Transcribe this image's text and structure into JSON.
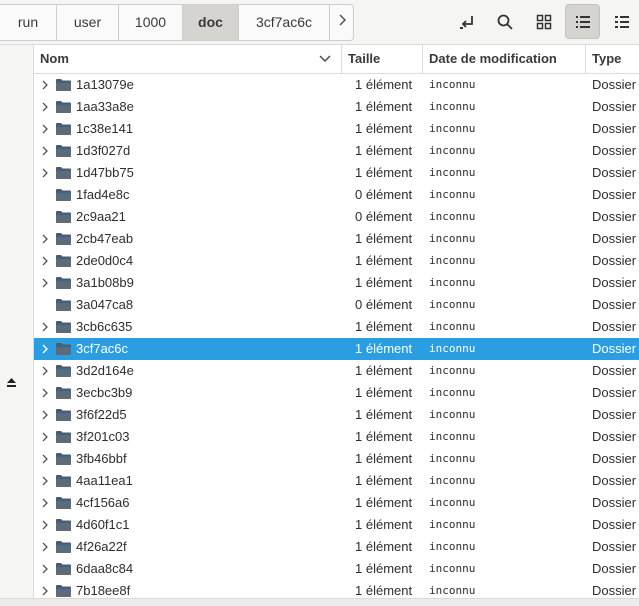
{
  "breadcrumb": {
    "items": [
      {
        "label": "run",
        "active": false
      },
      {
        "label": "user",
        "active": false
      },
      {
        "label": "1000",
        "active": false
      },
      {
        "label": "doc",
        "active": true
      },
      {
        "label": "3cf7ac6c",
        "active": false
      }
    ],
    "next_icon": "chevron-right-icon"
  },
  "toolbar": {
    "buttons": [
      {
        "icon": "open-location-icon"
      },
      {
        "icon": "search-icon"
      },
      {
        "icon": "grid-view-icon"
      },
      {
        "icon": "list-view-icon",
        "active": true
      },
      {
        "icon": "menu-icon"
      }
    ]
  },
  "columns": {
    "name": "Nom",
    "size": "Taille",
    "date": "Date de modification",
    "type": "Type"
  },
  "rows": [
    {
      "name": "1a13079e",
      "size": "1 élément",
      "date": "inconnu",
      "type": "Dossier",
      "expandable": true,
      "selected": false
    },
    {
      "name": "1aa33a8e",
      "size": "1 élément",
      "date": "inconnu",
      "type": "Dossier",
      "expandable": true,
      "selected": false
    },
    {
      "name": "1c38e141",
      "size": "1 élément",
      "date": "inconnu",
      "type": "Dossier",
      "expandable": true,
      "selected": false
    },
    {
      "name": "1d3f027d",
      "size": "1 élément",
      "date": "inconnu",
      "type": "Dossier",
      "expandable": true,
      "selected": false
    },
    {
      "name": "1d47bb75",
      "size": "1 élément",
      "date": "inconnu",
      "type": "Dossier",
      "expandable": true,
      "selected": false
    },
    {
      "name": "1fad4e8c",
      "size": "0 élément",
      "date": "inconnu",
      "type": "Dossier",
      "expandable": false,
      "selected": false
    },
    {
      "name": "2c9aa21",
      "size": "0 élément",
      "date": "inconnu",
      "type": "Dossier",
      "expandable": false,
      "selected": false
    },
    {
      "name": "2cb47eab",
      "size": "1 élément",
      "date": "inconnu",
      "type": "Dossier",
      "expandable": true,
      "selected": false
    },
    {
      "name": "2de0d0c4",
      "size": "1 élément",
      "date": "inconnu",
      "type": "Dossier",
      "expandable": true,
      "selected": false
    },
    {
      "name": "3a1b08b9",
      "size": "1 élément",
      "date": "inconnu",
      "type": "Dossier",
      "expandable": true,
      "selected": false
    },
    {
      "name": "3a047ca8",
      "size": "0 élément",
      "date": "inconnu",
      "type": "Dossier",
      "expandable": false,
      "selected": false
    },
    {
      "name": "3cb6c635",
      "size": "1 élément",
      "date": "inconnu",
      "type": "Dossier",
      "expandable": true,
      "selected": false
    },
    {
      "name": "3cf7ac6c",
      "size": "1 élément",
      "date": "inconnu",
      "type": "Dossier",
      "expandable": true,
      "selected": true
    },
    {
      "name": "3d2d164e",
      "size": "1 élément",
      "date": "inconnu",
      "type": "Dossier",
      "expandable": true,
      "selected": false
    },
    {
      "name": "3ecbc3b9",
      "size": "1 élément",
      "date": "inconnu",
      "type": "Dossier",
      "expandable": true,
      "selected": false
    },
    {
      "name": "3f6f22d5",
      "size": "1 élément",
      "date": "inconnu",
      "type": "Dossier",
      "expandable": true,
      "selected": false
    },
    {
      "name": "3f201c03",
      "size": "1 élément",
      "date": "inconnu",
      "type": "Dossier",
      "expandable": true,
      "selected": false
    },
    {
      "name": "3fb46bbf",
      "size": "1 élément",
      "date": "inconnu",
      "type": "Dossier",
      "expandable": true,
      "selected": false
    },
    {
      "name": "4aa11ea1",
      "size": "1 élément",
      "date": "inconnu",
      "type": "Dossier",
      "expandable": true,
      "selected": false
    },
    {
      "name": "4cf156a6",
      "size": "1 élément",
      "date": "inconnu",
      "type": "Dossier",
      "expandable": true,
      "selected": false
    },
    {
      "name": "4d60f1c1",
      "size": "1 élément",
      "date": "inconnu",
      "type": "Dossier",
      "expandable": true,
      "selected": false
    },
    {
      "name": "4f26a22f",
      "size": "1 élément",
      "date": "inconnu",
      "type": "Dossier",
      "expandable": true,
      "selected": false
    },
    {
      "name": "6daa8c84",
      "size": "1 élément",
      "date": "inconnu",
      "type": "Dossier",
      "expandable": true,
      "selected": false
    },
    {
      "name": "7b18ee8f",
      "size": "1 élément",
      "date": "inconnu",
      "type": "Dossier",
      "expandable": true,
      "selected": false
    }
  ],
  "colors": {
    "selection": "#2a9ee0",
    "folder": "#4f5b66",
    "folder_tab": "#3a6ea5"
  },
  "sidebar": {
    "eject_icon": "eject-icon"
  }
}
